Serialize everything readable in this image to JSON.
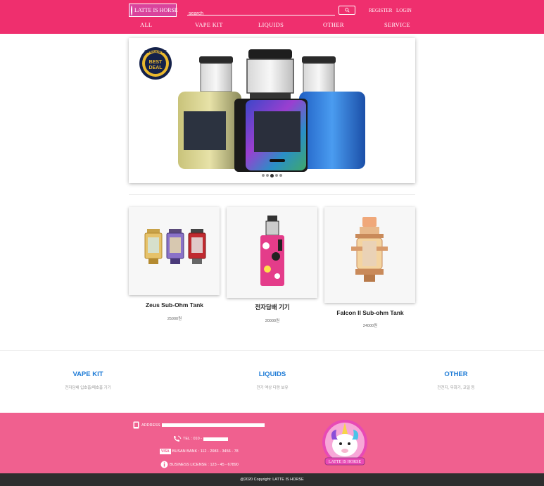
{
  "header": {
    "logo_text": "LATTE IS HORSE",
    "search_placeholder": "search",
    "register": "REGISTER",
    "login": "LOGIN",
    "nav": [
      "ALL",
      "VAPE KIT",
      "LIQUIDS",
      "OTHER",
      "SERVICE"
    ]
  },
  "slider": {
    "badge_lines": [
      "GUARANTEE",
      "BEST",
      "DEAL"
    ],
    "dot_count": 5,
    "active_dot": 2
  },
  "products": [
    {
      "name": "Zeus Sub-Ohm Tank",
      "price": "25000원"
    },
    {
      "name": "전자담배 기기",
      "price": "20000원"
    },
    {
      "name": "Falcon II Sub-ohm Tank",
      "price": "24000원"
    }
  ],
  "categories": [
    {
      "title": "VAPE KIT",
      "desc": "전자담배 입호흡/폐호흡 기기"
    },
    {
      "title": "LIQUIDS",
      "desc": "전기 액상 다량 보유"
    },
    {
      "title": "OTHER",
      "desc": "전전지, 무화기, 코일 등"
    }
  ],
  "footer": {
    "address_label": "ADDRESS",
    "tel_label": "TEL : 010 -",
    "bank": "BUSAN BANK : 112 - 2083 - 3456 - 78",
    "license": "BUSINESS LICENSE : 123 - 45 - 67890",
    "visa_text": "VISA",
    "mascot_text": "LATTE IS HORSE"
  },
  "copyright": "@2020 Copyright: LATTE IS HORSE",
  "colors": {
    "header": "#ef2f6e",
    "footer": "#f0608f",
    "category_title": "#1e7bd6",
    "copyright_bar": "#2e2e2e"
  }
}
